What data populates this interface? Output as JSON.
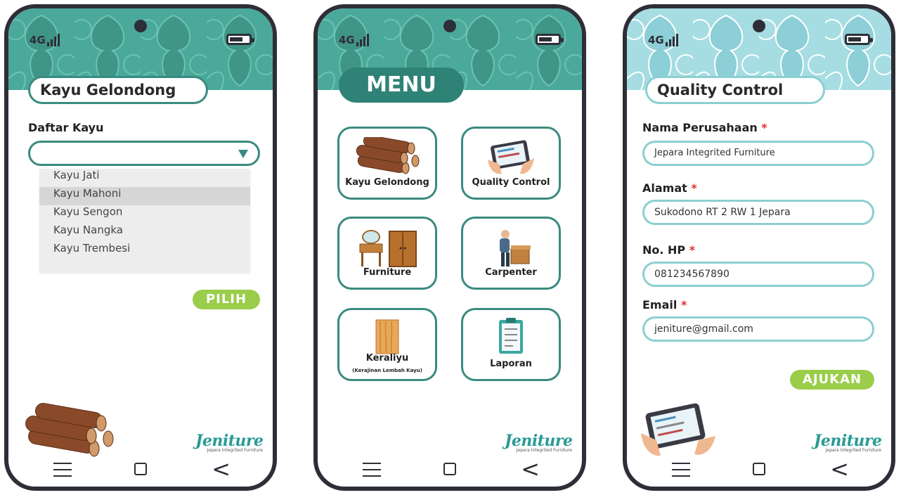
{
  "status": {
    "network": "4G"
  },
  "brand": {
    "name": "Jeniture",
    "tagline": "Jepara Integrited Furniture"
  },
  "nav": {
    "back_glyph": "<"
  },
  "screen1": {
    "title": "Kayu Gelondong",
    "list_label": "Daftar Kayu",
    "options": [
      "Kayu Jati",
      "Kayu Mahoni",
      "Kayu Sengon",
      "Kayu Nangka",
      "Kayu Trembesi"
    ],
    "highlighted_option": "Kayu Mahoni",
    "submit_label": "PILIH"
  },
  "screen2": {
    "title": "MENU",
    "items": [
      {
        "label": "Kayu Gelondong",
        "icon": "log-pile-icon"
      },
      {
        "label": "Quality Control",
        "icon": "tablet-checklist-icon"
      },
      {
        "label": "Furniture",
        "icon": "furniture-icon"
      },
      {
        "label": "Carpenter",
        "icon": "carpenter-icon"
      },
      {
        "label": "Keraliyu",
        "sublabel": "(Kerajinan Lembah Kayu)",
        "icon": "wood-block-icon"
      },
      {
        "label": "Laporan",
        "icon": "clipboard-report-icon"
      }
    ]
  },
  "screen3": {
    "title": "Quality Control",
    "fields": [
      {
        "label": "Nama Perusahaan",
        "value": "Jepara Integrited Furniture"
      },
      {
        "label": "Alamat",
        "value": "Sukodono RT 2 RW 1 Jepara"
      },
      {
        "label": "No. HP",
        "value": "081234567890"
      },
      {
        "label": "Email",
        "value": "jeniture@gmail.com"
      }
    ],
    "required_mark": "*",
    "submit_label": "AJUKAN"
  },
  "colors": {
    "teal": "#3a8a80",
    "teal_dark": "#2f8276",
    "light_teal": "#8ccfd0",
    "green_button": "#9acd4a",
    "frame": "#2e2e38"
  }
}
